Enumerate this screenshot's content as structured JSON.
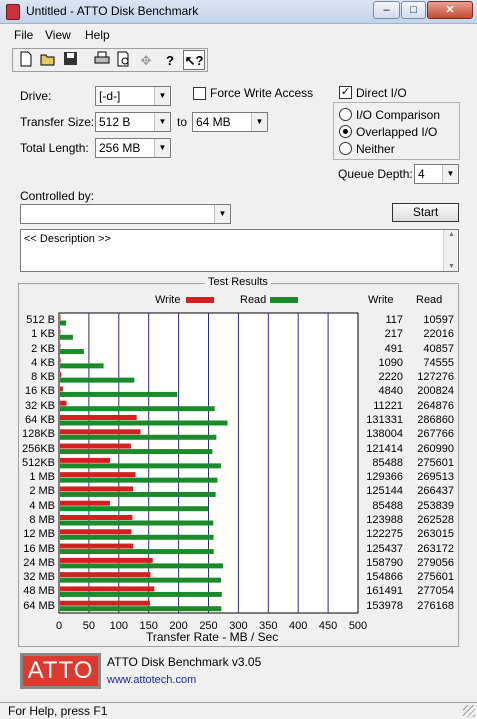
{
  "window": {
    "title": "Untitled - ATTO Disk Benchmark",
    "minimize": "–",
    "maximize": "□",
    "close": "✕"
  },
  "menu": {
    "file": "File",
    "view": "View",
    "help": "Help"
  },
  "toolbar": {
    "icons": [
      "new-icon",
      "open-icon",
      "save-icon",
      "print-icon",
      "print-preview-icon",
      "move-icon",
      "help-icon",
      "context-help-icon"
    ]
  },
  "form": {
    "drive_label": "Drive:",
    "drive_value": "[-d-]",
    "force_write_label": "Force Write Access",
    "force_write_checked": false,
    "direct_io_label": "Direct I/O",
    "direct_io_checked": true,
    "transfer_size_label": "Transfer Size:",
    "transfer_from": "512 B",
    "to_label": "to",
    "transfer_to": "64 MB",
    "total_length_label": "Total Length:",
    "total_length": "256 MB",
    "io_comparison_label": "I/O Comparison",
    "overlapped_io_label": "Overlapped I/O",
    "neither_label": "Neither",
    "selected_mode": "Overlapped I/O",
    "queue_depth_label": "Queue Depth:",
    "queue_depth": "4",
    "controlled_by_label": "Controlled by:",
    "controlled_by_value": "",
    "start_label": "Start",
    "description": "<< Description >>"
  },
  "results": {
    "group_title": "Test Results",
    "write_legend": "Write",
    "read_legend": "Read",
    "write_col": "Write",
    "read_col": "Read",
    "x_axis_label": "Transfer Rate - MB / Sec"
  },
  "chart_data": {
    "type": "bar",
    "orientation": "horizontal",
    "categories": [
      "512 B",
      "1 KB",
      "2 KB",
      "4 KB",
      "8 KB",
      "16 KB",
      "32 KB",
      "64 KB",
      "128KB",
      "256KB",
      "512KB",
      "1 MB",
      "2 MB",
      "4 MB",
      "8 MB",
      "12 MB",
      "16 MB",
      "24 MB",
      "32 MB",
      "48 MB",
      "64 MB"
    ],
    "series": [
      {
        "name": "Write",
        "color": "#d42020",
        "values": [
          117,
          217,
          491,
          1090,
          2220,
          4840,
          11221,
          131331,
          138004,
          121414,
          85488,
          129366,
          125144,
          85488,
          123988,
          122275,
          125437,
          158790,
          154866,
          161491,
          153978
        ]
      },
      {
        "name": "Read",
        "color": "#1a8a2a",
        "values": [
          10597,
          22016,
          40857,
          74555,
          127276,
          200824,
          264876,
          286860,
          267766,
          260990,
          275601,
          269513,
          266437,
          253839,
          262528,
          263015,
          263172,
          279056,
          275601,
          277054,
          276168
        ]
      }
    ],
    "value_unit": "KB/s",
    "xlabel": "Transfer Rate - MB / Sec",
    "xlim": [
      0,
      500
    ],
    "xticks": [
      "0",
      "50",
      "100",
      "150",
      "200",
      "250",
      "300",
      "350",
      "400",
      "450",
      "500"
    ],
    "legend": "top",
    "grid": true
  },
  "footer": {
    "logo_text": "ATTO",
    "version": "ATTO Disk Benchmark v3.05",
    "url": "www.attotech.com",
    "status": "For Help, press F1"
  }
}
